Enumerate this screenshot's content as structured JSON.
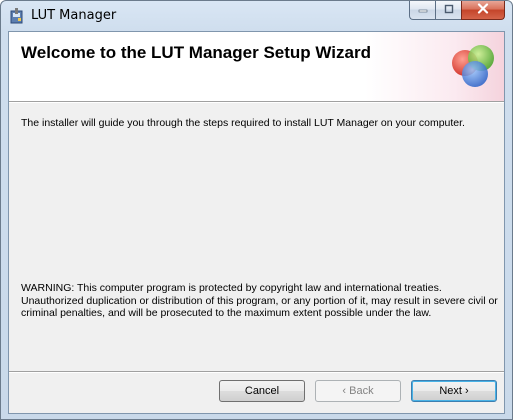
{
  "window": {
    "title": "LUT Manager"
  },
  "banner": {
    "title": "Welcome to the LUT Manager Setup Wizard"
  },
  "body": {
    "intro": "The installer will guide you through the steps required to install LUT Manager on your computer.",
    "warning": "WARNING: This computer program is protected by copyright law and international treaties. Unauthorized duplication or distribution of this program, or any portion of it, may result in severe civil or criminal penalties, and will be prosecuted to the maximum extent possible under the law."
  },
  "buttons": {
    "cancel": "Cancel",
    "back": "‹ Back",
    "next": "Next ›",
    "back_enabled": false
  },
  "icons": {
    "title_icon": "installer-icon",
    "banner_logo": "setup-circles-logo",
    "minimize": "minimize-icon",
    "maximize": "maximize-icon",
    "close": "close-icon"
  },
  "colors": {
    "logo_red": "#e0463a",
    "logo_green": "#6cc24a",
    "logo_blue": "#3a7fd9"
  }
}
